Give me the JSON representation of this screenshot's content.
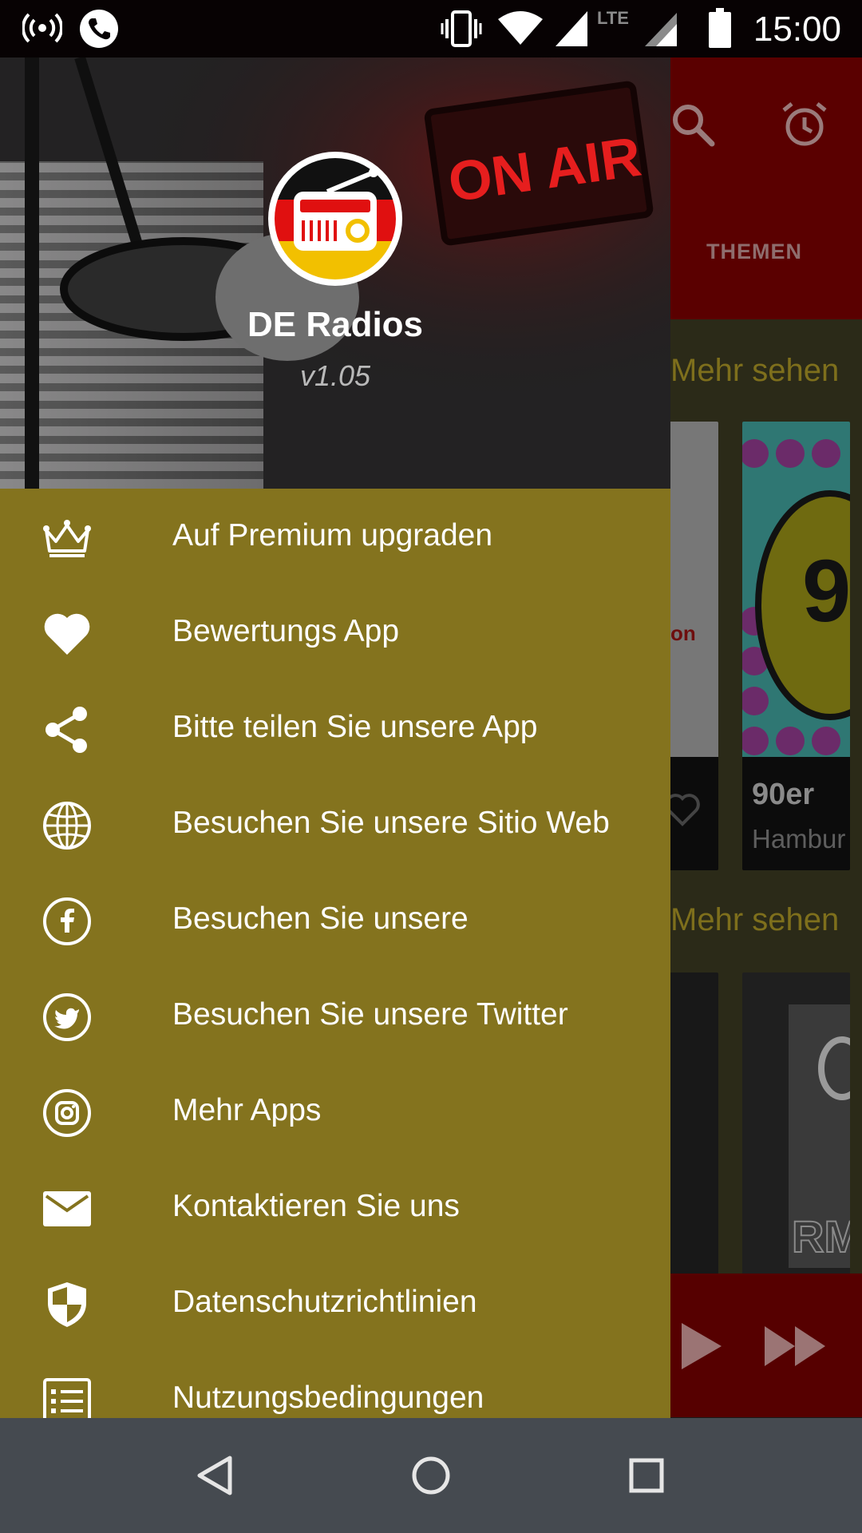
{
  "status_bar": {
    "time": "15:00",
    "network_label": "LTE",
    "icons": [
      "hotspot-icon",
      "phone-call-icon",
      "vibrate-icon",
      "wifi-icon",
      "signal-icon",
      "signal-lte-icon",
      "battery-icon"
    ]
  },
  "background": {
    "tab_label": "THEMEN",
    "section_more_labels": [
      "Mehr sehen",
      "Mehr sehen"
    ],
    "card": {
      "title": "90er",
      "subtitle": "Hambur"
    },
    "card_snippet": "on",
    "card_logo_snippet": "9",
    "card_logo_snippet2": "RM",
    "colors": {
      "toolbar": "#5a0000",
      "accent": "#7e6f1c"
    }
  },
  "drawer": {
    "app_name": "DE Radios",
    "version": "v1.05",
    "header_sign": "ON AIR",
    "background_color": "#84731e",
    "items": [
      {
        "label": "Auf Premium upgraden",
        "icon": "crown-icon"
      },
      {
        "label": "Bewertungs App",
        "icon": "heart-icon"
      },
      {
        "label": "Bitte teilen Sie unsere App",
        "icon": "share-icon"
      },
      {
        "label": "Besuchen Sie unsere Sitio Web",
        "icon": "globe-icon"
      },
      {
        "label": "Besuchen Sie unsere",
        "icon": "facebook-icon"
      },
      {
        "label": "Besuchen Sie unsere Twitter",
        "icon": "twitter-icon"
      },
      {
        "label": "Mehr Apps",
        "icon": "instagram-icon"
      },
      {
        "label": "Kontaktieren Sie uns",
        "icon": "mail-icon"
      },
      {
        "label": "Datenschutzrichtlinien",
        "icon": "shield-icon"
      },
      {
        "label": "Nutzungsbedingungen",
        "icon": "list-icon"
      }
    ]
  },
  "nav_bar": {
    "buttons": [
      "back-icon",
      "home-icon",
      "recents-icon"
    ]
  }
}
